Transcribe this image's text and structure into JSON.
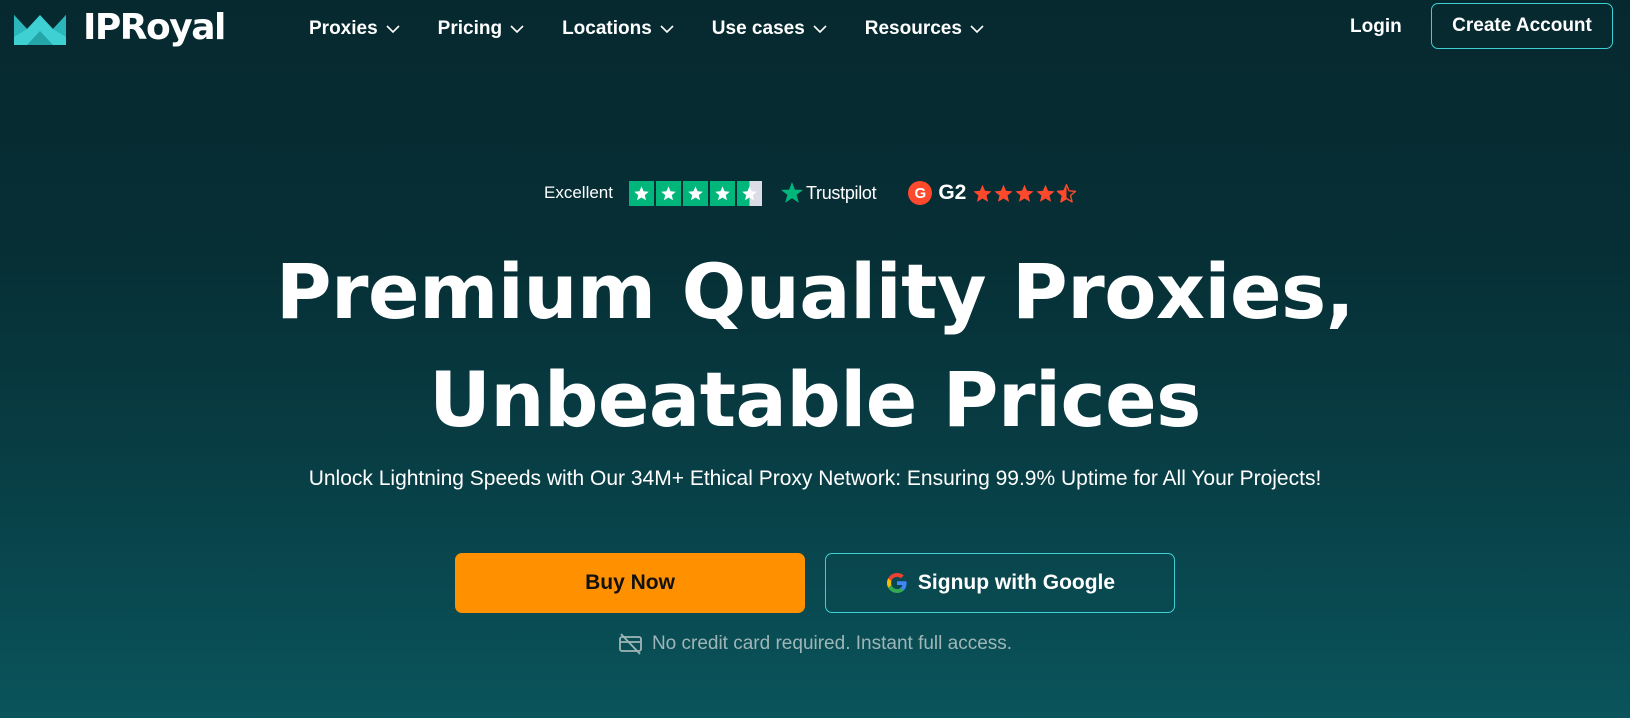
{
  "brand": {
    "name": "IPRoyal",
    "logo_icon": "crown-icon",
    "accent": "#3fd0d4"
  },
  "nav": {
    "items": [
      {
        "label": "Proxies"
      },
      {
        "label": "Pricing"
      },
      {
        "label": "Locations"
      },
      {
        "label": "Use cases"
      },
      {
        "label": "Resources"
      }
    ],
    "login_label": "Login",
    "create_account_label": "Create Account"
  },
  "ratings": {
    "trustpilot": {
      "label": "Excellent",
      "brand": "Trustpilot",
      "stars": 4.5,
      "color": "#00b67a"
    },
    "g2": {
      "badge": "G",
      "brand": "G2",
      "stars": 4.5,
      "color": "#ff492c"
    }
  },
  "hero": {
    "title_line1": "Premium Quality Proxies,",
    "title_line2": "Unbeatable Prices",
    "subtitle": "Unlock Lightning Speeds with Our 34M+ Ethical Proxy Network: Ensuring 99.9% Uptime for All Your Projects!",
    "buy_label": "Buy Now",
    "buy_color": "#ff9100",
    "google_label": "Signup with Google",
    "note": "No credit card required. Instant full access."
  }
}
